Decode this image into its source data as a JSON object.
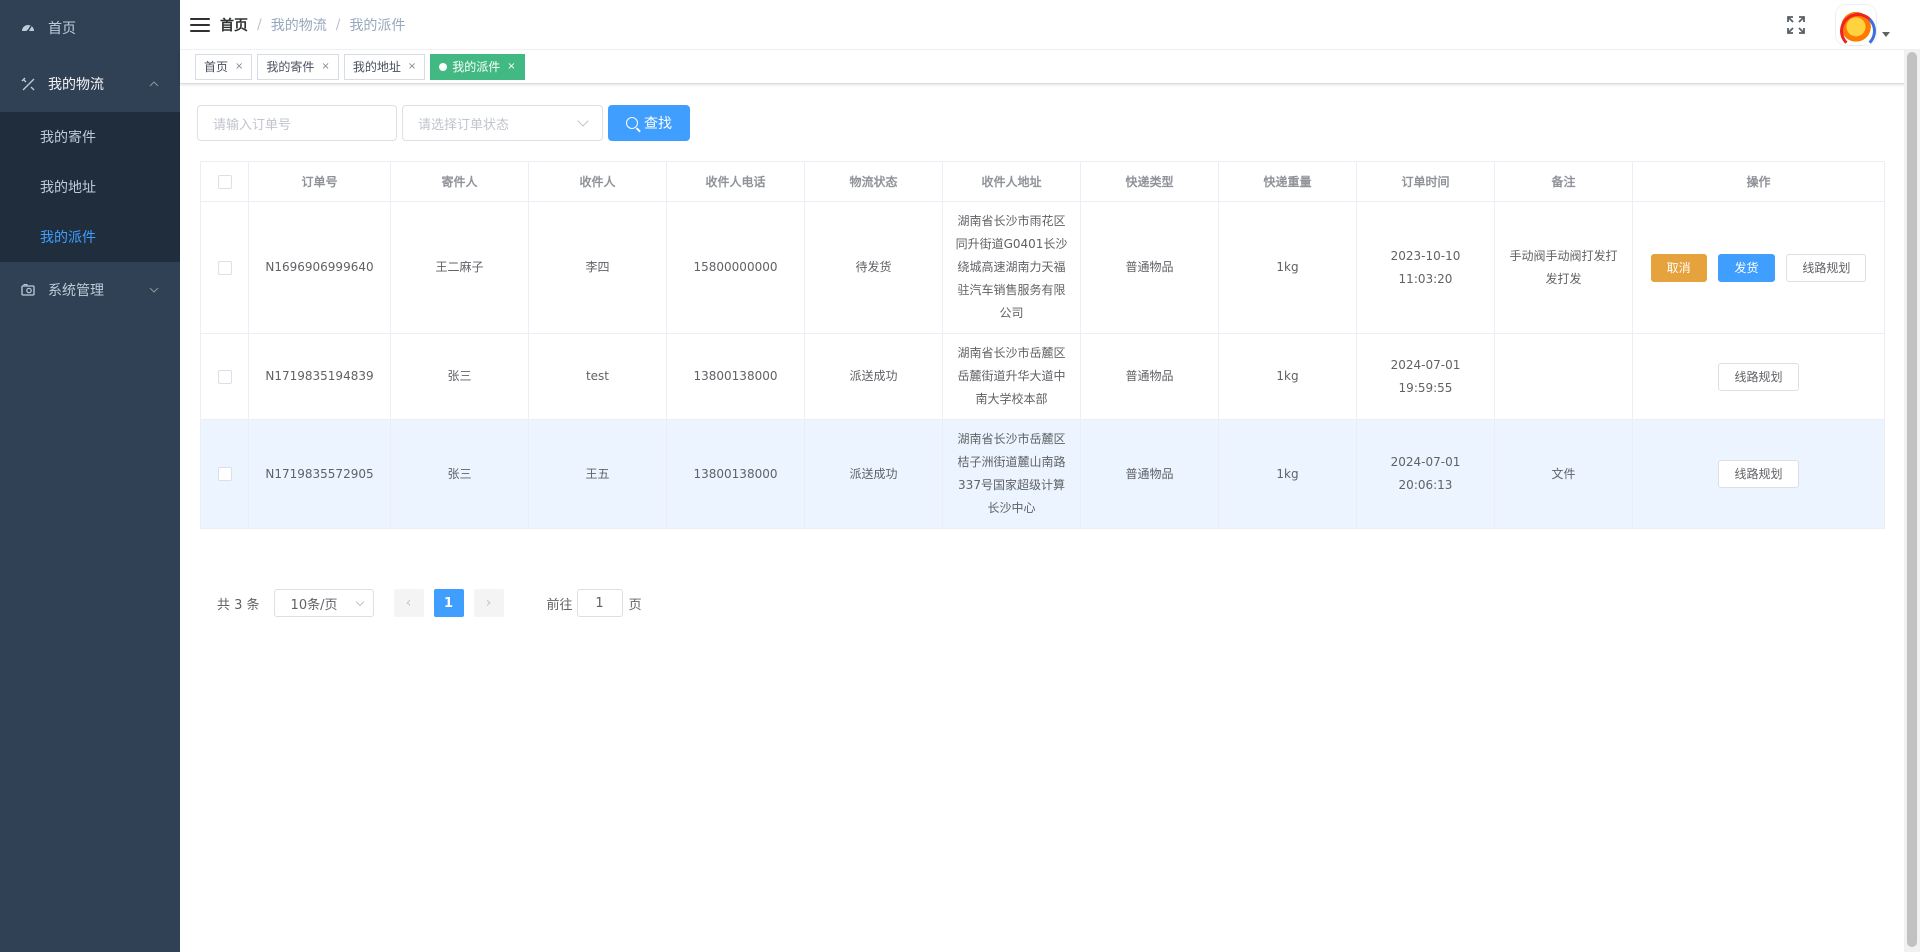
{
  "sidebar": {
    "home": {
      "label": "首页",
      "icon": "dashboard-icon"
    },
    "logistics": {
      "label": "我的物流",
      "icon": "tools-icon"
    },
    "logistics_items": [
      {
        "label": "我的寄件"
      },
      {
        "label": "我的地址"
      },
      {
        "label": "我的派件"
      }
    ],
    "system": {
      "label": "系统管理",
      "icon": "system-icon"
    }
  },
  "breadcrumb": [
    "首页",
    "我的物流",
    "我的派件"
  ],
  "tags": [
    {
      "label": "首页",
      "close": "×"
    },
    {
      "label": "我的寄件",
      "close": "×"
    },
    {
      "label": "我的地址",
      "close": "×"
    },
    {
      "label": "我的派件",
      "close": "×",
      "active": true
    }
  ],
  "search": {
    "order_placeholder": "请输入订单号",
    "status_placeholder": "请选择订单状态",
    "search_button": "查找"
  },
  "table": {
    "headers": [
      "订单号",
      "寄件人",
      "收件人",
      "收件人电话",
      "物流状态",
      "收件人地址",
      "快递类型",
      "快递重量",
      "订单时间",
      "备注",
      "操作"
    ],
    "rows": [
      {
        "order_no": "N1696906999640",
        "sender": "王二麻子",
        "receiver": "李四",
        "phone": "15800000000",
        "status": "待发货",
        "address": "湖南省长沙市雨花区同升街道G0401长沙绕城高速湖南力天福驻汽车销售服务有限公司",
        "type": "普通物品",
        "weight": "1kg",
        "time": "2023-10-10 11:03:20",
        "note": "手动阀手动阀打发打发打发",
        "actions": {
          "cancel": "取消",
          "ship": "发货",
          "route": "线路规划"
        }
      },
      {
        "order_no": "N1719835194839",
        "sender": "张三",
        "receiver": "test",
        "phone": "13800138000",
        "status": "派送成功",
        "address": "湖南省长沙市岳麓区岳麓街道升华大道中南大学校本部",
        "type": "普通物品",
        "weight": "1kg",
        "time": "2024-07-01 19:59:55",
        "note": "",
        "actions": {
          "route": "线路规划"
        }
      },
      {
        "order_no": "N1719835572905",
        "sender": "张三",
        "receiver": "王五",
        "phone": "13800138000",
        "status": "派送成功",
        "address": "湖南省长沙市岳麓区桔子洲街道麓山南路337号国家超级计算长沙中心",
        "type": "普通物品",
        "weight": "1kg",
        "time": "2024-07-01 20:06:13",
        "note": "文件",
        "actions": {
          "route": "线路规划"
        }
      }
    ]
  },
  "pagination": {
    "total": "共 3 条",
    "page_size": "10条/页",
    "prev": "‹",
    "current": "1",
    "next": "›",
    "goto_label": "前往",
    "goto_value": "1",
    "page_suffix": "页"
  },
  "colors": {
    "sidebar_bg": "#304156",
    "submenu_bg": "#1f2d3d",
    "primary": "#409eff",
    "active_tag": "#42b983",
    "warning": "#e6a23c"
  }
}
